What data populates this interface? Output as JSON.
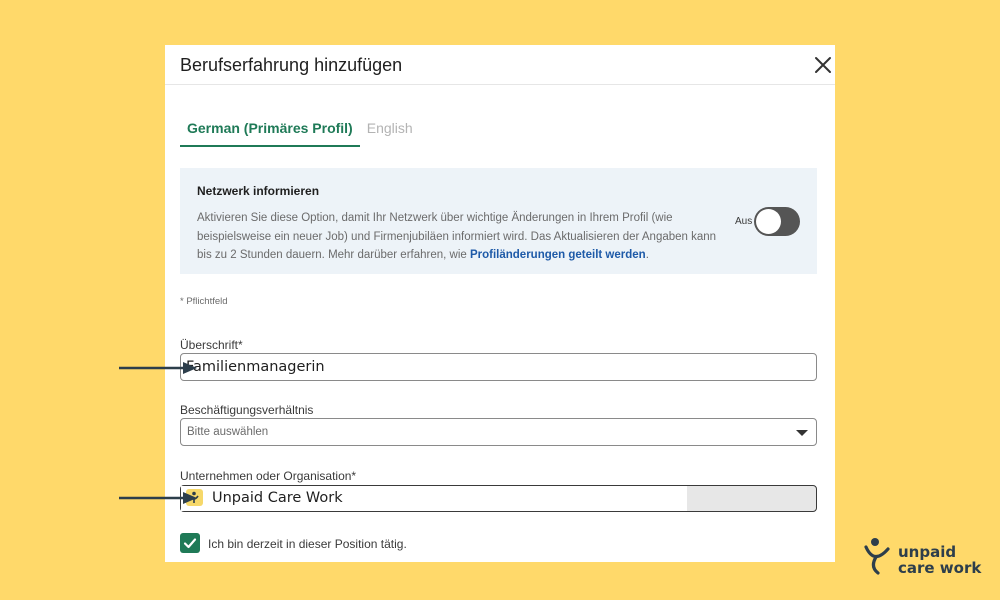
{
  "dialog": {
    "title": "Berufserfahrung hinzufügen",
    "tabs": [
      {
        "label": "German (Primäres Profil)",
        "active": true
      },
      {
        "label": "English",
        "active": false
      }
    ],
    "notify": {
      "title": "Netzwerk informieren",
      "text_before": "Aktivieren Sie diese Option, damit Ihr Netzwerk über wichtige Änderungen in Ihrem Profil (wie beispielsweise ein neuer Job) und Firmenjubiläen informiert wird. Das Aktualisieren der Angaben kann bis zu 2 Stunden dauern. Mehr darüber erfahren, wie ",
      "link_text": "Profiländerungen geteilt werden",
      "text_after": ".",
      "toggle_label": "Aus",
      "toggle_on": false
    },
    "required_note": "* Pflichtfeld",
    "fields": {
      "heading": {
        "label": "Überschrift*",
        "value": "Familienmanagerin"
      },
      "employment": {
        "label": "Beschäftigungsverhältnis",
        "placeholder": "Bitte auswählen"
      },
      "company": {
        "label": "Unternehmen oder Organisation*",
        "value": "Unpaid Care Work"
      }
    },
    "current_position": {
      "label": "Ich bin derzeit in dieser Position tätig.",
      "checked": true
    }
  },
  "brand": {
    "line1": "unpaid",
    "line2": "care work"
  },
  "colors": {
    "background": "#FFD96A",
    "accent": "#1f7a57",
    "link": "#1e5aa8",
    "info_box": "#edf3f8"
  }
}
